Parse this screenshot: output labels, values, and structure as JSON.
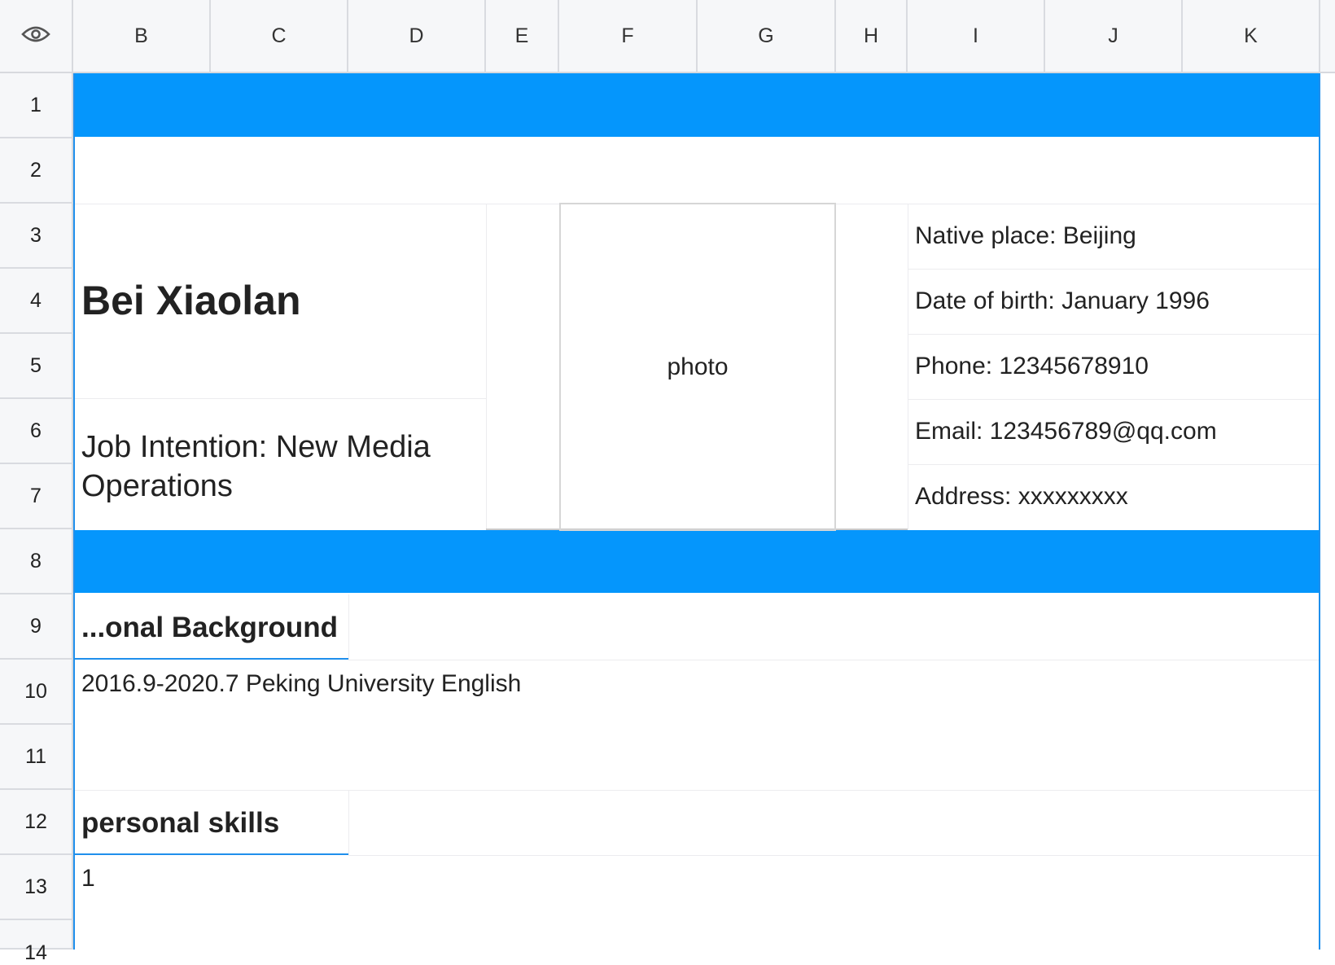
{
  "header": {
    "corner_icon": "eye-icon",
    "columns": [
      "B",
      "C",
      "D",
      "E",
      "F",
      "G",
      "H",
      "I",
      "J",
      "K"
    ],
    "rows": [
      "1",
      "2",
      "3",
      "4",
      "5",
      "6",
      "7",
      "8",
      "9",
      "10",
      "11",
      "12",
      "13",
      "14"
    ]
  },
  "colors": {
    "accent_band": "#0596fc",
    "selection_outline": "#1f8fec"
  },
  "resume": {
    "name": "Bei Xiaolan",
    "job_intention_line1": "Job Intention: New Media",
    "job_intention_line2": "Operations",
    "photo_label": "photo",
    "info": {
      "native_place": "Native place: Beijing",
      "date_of_birth": "Date of birth: January 1996",
      "phone": "Phone: 12345678910",
      "email": "Email: 123456789@qq.com",
      "address": "Address: xxxxxxxxx"
    },
    "education_title": "...onal Background",
    "education_entry": "2016.9-2020.7 Peking University English",
    "skills_title": "personal skills",
    "skills_entry": "1"
  }
}
